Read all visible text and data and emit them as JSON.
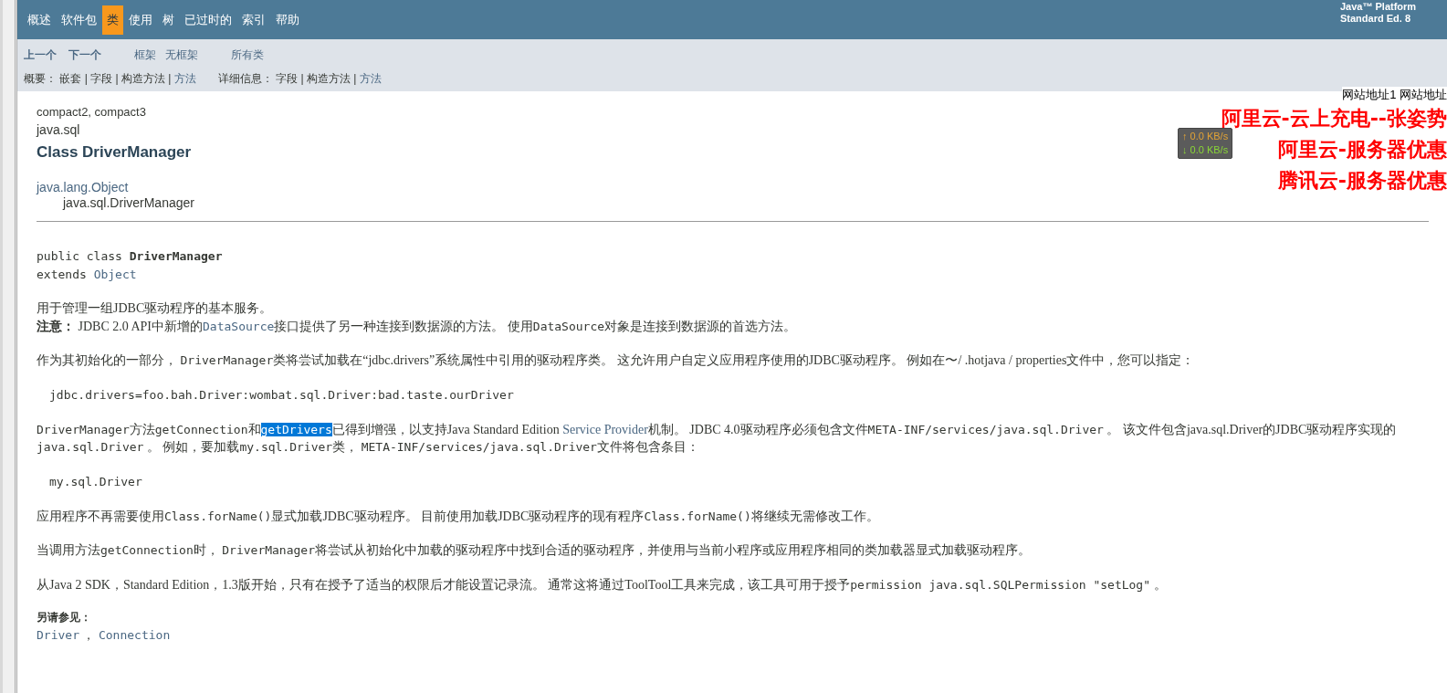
{
  "nav": {
    "items": [
      {
        "label": "概述",
        "selected": false
      },
      {
        "label": "软件包",
        "selected": false
      },
      {
        "label": "类",
        "selected": true
      },
      {
        "label": "使用",
        "selected": false
      },
      {
        "label": "树",
        "selected": false
      },
      {
        "label": "已过时的",
        "selected": false
      },
      {
        "label": "索引",
        "selected": false
      },
      {
        "label": "帮助",
        "selected": false
      }
    ],
    "brand": [
      "Java™ Platform",
      "Standard Ed. 8"
    ]
  },
  "subnav": {
    "links": [
      {
        "label": "上一个",
        "kind": "bold"
      },
      {
        "label": "下一个",
        "kind": "bold"
      },
      {
        "label": "框架",
        "kind": "link"
      },
      {
        "label": "无框架",
        "kind": "link"
      },
      {
        "label": "所有类",
        "kind": "link"
      }
    ],
    "summary": [
      {
        "text": "概要： ",
        "kind": "label"
      },
      {
        "text": "嵌套",
        "kind": "text"
      },
      {
        "text": " | ",
        "kind": "text"
      },
      {
        "text": "字段",
        "kind": "text"
      },
      {
        "text": " | ",
        "kind": "text"
      },
      {
        "text": "构造方法",
        "kind": "text"
      },
      {
        "text": " | ",
        "kind": "text"
      },
      {
        "text": "方法",
        "kind": "link"
      }
    ],
    "detail": [
      {
        "text": "详细信息： ",
        "kind": "label"
      },
      {
        "text": "字段",
        "kind": "text"
      },
      {
        "text": " | ",
        "kind": "text"
      },
      {
        "text": "构造方法",
        "kind": "text"
      },
      {
        "text": " | ",
        "kind": "text"
      },
      {
        "text": "方法",
        "kind": "link"
      }
    ]
  },
  "header": {
    "profiles": "compact2, compact3",
    "package": "java.sql",
    "title": "Class DriverManager"
  },
  "inheritance": {
    "parent": "java.lang.Object",
    "child": "java.sql.DriverManager"
  },
  "declaration": [
    [
      {
        "text": "public class ",
        "kind": "code"
      },
      {
        "text": "DriverManager",
        "kind": "codebold"
      }
    ],
    [
      {
        "text": "extends ",
        "kind": "code"
      },
      {
        "text": "Object",
        "kind": "codelink"
      }
    ]
  ],
  "blocks": [
    {
      "kind": "para",
      "lines": [
        [
          {
            "text": "用于管理一组JDBC驱动程序的基本服务。",
            "kind": "text"
          }
        ],
        [
          {
            "text": "注意： ",
            "kind": "bold"
          },
          {
            "text": " JDBC 2.0 API中新增的",
            "kind": "text"
          },
          {
            "text": "DataSource",
            "kind": "codelink"
          },
          {
            "text": "接口提供了另一种连接到数据源的方法。 使用",
            "kind": "text"
          },
          {
            "text": "DataSource",
            "kind": "code"
          },
          {
            "text": "对象是连接到数据源的首选方法。",
            "kind": "text"
          }
        ]
      ]
    },
    {
      "kind": "para",
      "lines": [
        [
          {
            "text": "作为其初始化的一部分， ",
            "kind": "text"
          },
          {
            "text": "DriverManager",
            "kind": "code"
          },
          {
            "text": "类将尝试加载在“jdbc.drivers”系统属性中引用的驱动程序类。 这允许用户自定义应用程序使用的JDBC驱动程序。 例如在〜/ .hotjava / properties文件中，您可以指定：",
            "kind": "text"
          }
        ]
      ]
    },
    {
      "kind": "pre",
      "text": "jdbc.drivers=foo.bah.Driver:wombat.sql.Driver:bad.taste.ourDriver"
    },
    {
      "kind": "para",
      "lines": [
        [
          {
            "text": "DriverManager",
            "kind": "code"
          },
          {
            "text": "方法",
            "kind": "text"
          },
          {
            "text": "getConnection",
            "kind": "code"
          },
          {
            "text": "和",
            "kind": "text"
          },
          {
            "text": "getDrivers",
            "kind": "selected"
          },
          {
            "text": "已得到增强，以支持Java Standard Edition ",
            "kind": "text"
          },
          {
            "text": "Service Provider",
            "kind": "link"
          },
          {
            "text": "机制。 JDBC 4.0驱动程序必须包含文件",
            "kind": "text"
          },
          {
            "text": "META-INF/services/java.sql.Driver",
            "kind": "code"
          },
          {
            "text": " 。 该文件包含java.sql.Driver的JDBC驱动程序实现的",
            "kind": "text"
          },
          {
            "text": "java.sql.Driver",
            "kind": "code"
          },
          {
            "text": " 。 例如，要加载",
            "kind": "text"
          },
          {
            "text": "my.sql.Driver",
            "kind": "code"
          },
          {
            "text": "类， ",
            "kind": "text"
          },
          {
            "text": "META-INF/services/java.sql.Driver",
            "kind": "code"
          },
          {
            "text": "文件将包含条目：",
            "kind": "text"
          }
        ]
      ]
    },
    {
      "kind": "pre",
      "text": "my.sql.Driver"
    },
    {
      "kind": "para",
      "lines": [
        [
          {
            "text": "应用程序不再需要使用",
            "kind": "text"
          },
          {
            "text": "Class.forName()",
            "kind": "code"
          },
          {
            "text": "显式加载JDBC驱动程序。 目前使用加载JDBC驱动程序的现有程序",
            "kind": "text"
          },
          {
            "text": "Class.forName()",
            "kind": "code"
          },
          {
            "text": "将继续无需修改工作。",
            "kind": "text"
          }
        ]
      ]
    },
    {
      "kind": "para",
      "lines": [
        [
          {
            "text": "当调用方法",
            "kind": "text"
          },
          {
            "text": "getConnection",
            "kind": "code"
          },
          {
            "text": "时， ",
            "kind": "text"
          },
          {
            "text": "DriverManager",
            "kind": "code"
          },
          {
            "text": "将尝试从初始化中加载的驱动程序中找到合适的驱动程序，并使用与当前小程序或应用程序相同的类加载器显式加载驱动程序。",
            "kind": "text"
          }
        ]
      ]
    },
    {
      "kind": "para",
      "lines": [
        [
          {
            "text": "从Java 2 SDK，Standard Edition，1.3版开始，只有在授予了适当的权限后才能设置记录流。 通常这将通过ToolTool工具来完成，该工具可用于授予",
            "kind": "text"
          },
          {
            "text": "permission java.sql.SQLPermission \"setLog\"",
            "kind": "code"
          },
          {
            "text": " 。",
            "kind": "text"
          }
        ]
      ]
    }
  ],
  "see_also": {
    "label": "另请参见：",
    "links": [
      {
        "text": "Driver",
        "kind": "codelink"
      },
      {
        "text": " ， ",
        "kind": "text"
      },
      {
        "text": "Connection",
        "kind": "codelink"
      }
    ]
  },
  "overlay": {
    "links": "网站地址1 网站地址",
    "ads": [
      "阿里云-云上充电--张姿势",
      "阿里云-服务器优惠",
      "腾讯云-服务器优惠"
    ],
    "speed": {
      "up": "↑ 0.0 KB/s",
      "down": "↓ 0.0 KB/s"
    }
  }
}
